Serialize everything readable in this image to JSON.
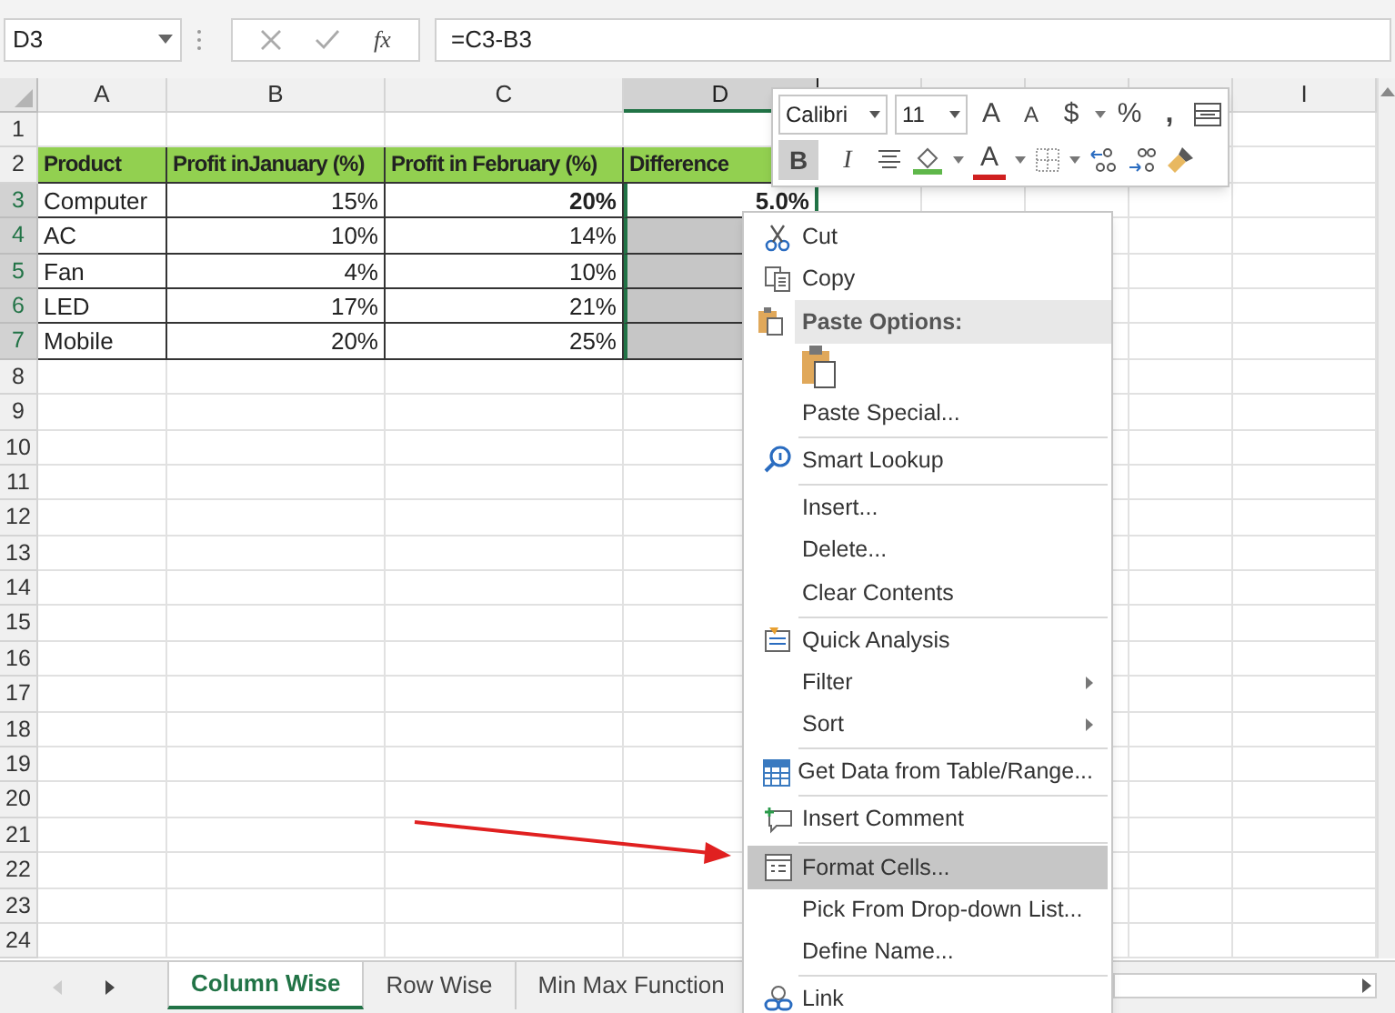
{
  "formula_bar": {
    "name_box": "D3",
    "fx": "fx",
    "formula": "=C3-B3"
  },
  "columns": [
    {
      "label": "A",
      "selected": false
    },
    {
      "label": "B",
      "selected": false
    },
    {
      "label": "C",
      "selected": false
    },
    {
      "label": "D",
      "selected": true
    },
    {
      "label": "I",
      "selected": false
    }
  ],
  "rows": [
    {
      "number": "1",
      "selected": false,
      "kind": "empty",
      "cells": []
    },
    {
      "number": "2",
      "selected": false,
      "kind": "header",
      "cells": [
        {
          "text": "Product"
        },
        {
          "text": "Profit inJanuary (%)"
        },
        {
          "text": "Profit in February (%)"
        },
        {
          "text": "Difference"
        }
      ]
    },
    {
      "number": "3",
      "selected": true,
      "kind": "data",
      "cells": [
        {
          "text": "Computer",
          "kind": "text",
          "bold": false,
          "selected": false
        },
        {
          "text": "15%",
          "kind": "number",
          "bold": false,
          "selected": false
        },
        {
          "text": "20%",
          "kind": "number",
          "bold": true,
          "selected": false
        },
        {
          "text": "5.0%",
          "kind": "number",
          "bold": true,
          "selected": false
        }
      ]
    },
    {
      "number": "4",
      "selected": true,
      "kind": "data",
      "cells": [
        {
          "text": "AC",
          "kind": "text",
          "bold": false,
          "selected": false
        },
        {
          "text": "10%",
          "kind": "number",
          "bold": false,
          "selected": false
        },
        {
          "text": "14%",
          "kind": "number",
          "bold": false,
          "selected": false
        },
        {
          "kind": "number",
          "bold": false,
          "selected": true
        }
      ]
    },
    {
      "number": "5",
      "selected": true,
      "kind": "data",
      "cells": [
        {
          "text": "Fan",
          "kind": "text",
          "bold": false,
          "selected": false
        },
        {
          "text": "4%",
          "kind": "number",
          "bold": false,
          "selected": false
        },
        {
          "text": "10%",
          "kind": "number",
          "bold": false,
          "selected": false
        },
        {
          "kind": "number",
          "bold": false,
          "selected": true
        }
      ]
    },
    {
      "number": "6",
      "selected": true,
      "kind": "data",
      "cells": [
        {
          "text": "LED",
          "kind": "text",
          "bold": false,
          "selected": false
        },
        {
          "text": "17%",
          "kind": "number",
          "bold": false,
          "selected": false
        },
        {
          "text": "21%",
          "kind": "number",
          "bold": false,
          "selected": false
        },
        {
          "kind": "number",
          "bold": false,
          "selected": true
        }
      ]
    },
    {
      "number": "7",
      "selected": true,
      "kind": "data",
      "cells": [
        {
          "text": "Mobile",
          "kind": "text",
          "bold": false,
          "selected": false
        },
        {
          "text": "20%",
          "kind": "number",
          "bold": false,
          "selected": false
        },
        {
          "text": "25%",
          "kind": "number",
          "bold": false,
          "selected": false
        },
        {
          "kind": "number",
          "bold": false,
          "selected": true
        }
      ]
    },
    {
      "number": "8",
      "selected": false,
      "kind": "empty",
      "cells": []
    },
    {
      "number": "9",
      "selected": false,
      "kind": "empty",
      "cells": []
    },
    {
      "number": "10",
      "selected": false,
      "kind": "empty",
      "cells": []
    },
    {
      "number": "11",
      "selected": false,
      "kind": "empty",
      "cells": []
    },
    {
      "number": "12",
      "selected": false,
      "kind": "empty",
      "cells": []
    },
    {
      "number": "13",
      "selected": false,
      "kind": "empty",
      "cells": []
    },
    {
      "number": "14",
      "selected": false,
      "kind": "empty",
      "cells": []
    },
    {
      "number": "15",
      "selected": false,
      "kind": "empty",
      "cells": []
    },
    {
      "number": "16",
      "selected": false,
      "kind": "empty",
      "cells": []
    },
    {
      "number": "17",
      "selected": false,
      "kind": "empty",
      "cells": []
    },
    {
      "number": "18",
      "selected": false,
      "kind": "empty",
      "cells": []
    },
    {
      "number": "19",
      "selected": false,
      "kind": "empty",
      "cells": []
    },
    {
      "number": "20",
      "selected": false,
      "kind": "empty",
      "cells": []
    },
    {
      "number": "21",
      "selected": false,
      "kind": "empty",
      "cells": []
    },
    {
      "number": "22",
      "selected": false,
      "kind": "empty",
      "cells": []
    },
    {
      "number": "23",
      "selected": false,
      "kind": "empty",
      "cells": []
    },
    {
      "number": "24",
      "selected": false,
      "kind": "empty",
      "cells": []
    }
  ],
  "mini_toolbar": {
    "font": "Calibri",
    "size": "11",
    "row_1": [
      {
        "kind": "grow",
        "label": "A"
      },
      {
        "kind": "shrink",
        "label": "A"
      },
      {
        "kind": "currency",
        "label": "$"
      },
      {
        "kind": "percent",
        "label": "%"
      },
      {
        "kind": "comma",
        "label": ","
      },
      {
        "kind": "wrap"
      }
    ],
    "row_2": [
      {
        "kind": "bold",
        "label": "B",
        "on": true
      },
      {
        "kind": "italic",
        "label": "I",
        "on": false
      },
      {
        "kind": "align"
      },
      {
        "kind": "fill"
      },
      {
        "kind": "font-color",
        "label": "A"
      },
      {
        "kind": "borders"
      },
      {
        "kind": "increase-decimal"
      },
      {
        "kind": "decrease-decimal"
      },
      {
        "kind": "painter"
      }
    ]
  },
  "context_menu": {
    "groups": [
      [
        {
          "kind": "command",
          "label": "Cut",
          "selected": false
        },
        {
          "kind": "command",
          "label": "Copy",
          "selected": false
        },
        {
          "kind": "header",
          "label": "Paste Options:",
          "selected": false
        },
        {
          "kind": "paste-button",
          "selected": false
        },
        {
          "kind": "command",
          "label": "Paste Special...",
          "selected": false
        }
      ],
      [
        {
          "kind": "command",
          "label": "Smart Lookup",
          "selected": false
        }
      ],
      [
        {
          "kind": "command",
          "label": "Insert...",
          "selected": false
        },
        {
          "kind": "command",
          "label": "Delete...",
          "selected": false
        },
        {
          "kind": "command",
          "label": "Clear Contents",
          "selected": false
        }
      ],
      [
        {
          "kind": "command",
          "label": "Quick Analysis",
          "selected": false
        },
        {
          "kind": "submenu",
          "label": "Filter",
          "selected": false
        },
        {
          "kind": "submenu",
          "label": "Sort",
          "selected": false
        }
      ],
      [
        {
          "kind": "command",
          "label": "Get Data from Table/Range...",
          "selected": false
        }
      ],
      [
        {
          "kind": "command",
          "label": "Insert Comment",
          "selected": false
        }
      ],
      [
        {
          "kind": "command",
          "label": "Format Cells...",
          "selected": true
        },
        {
          "kind": "command",
          "label": "Pick From Drop-down List...",
          "selected": false
        },
        {
          "kind": "command",
          "label": "Define Name...",
          "selected": false
        }
      ],
      [
        {
          "kind": "command",
          "label": "Link",
          "selected": false
        }
      ]
    ]
  },
  "sheet_tabs": [
    {
      "label": "Column Wise",
      "selected": true
    },
    {
      "label": "Row Wise",
      "selected": false
    },
    {
      "label": "Min Max Function",
      "selected": false
    }
  ]
}
